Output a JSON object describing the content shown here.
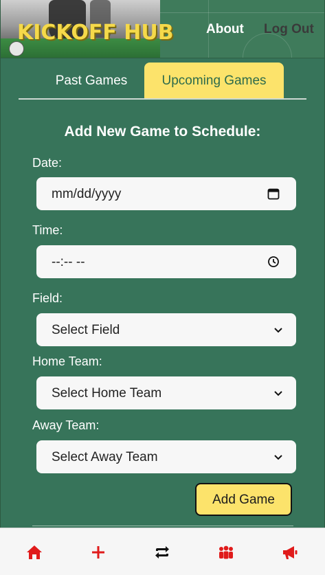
{
  "header": {
    "logo_text": "KICKOFF HUB",
    "nav": {
      "about": "About",
      "logout": "Log Out"
    }
  },
  "tabs": [
    {
      "label": "Past Games",
      "active": false
    },
    {
      "label": "Upcoming Games",
      "active": true
    }
  ],
  "form": {
    "title": "Add New Game to Schedule:",
    "date": {
      "label": "Date:",
      "placeholder": "mm/dd/yyyy"
    },
    "time": {
      "label": "Time:",
      "placeholder": "--:-- --"
    },
    "field": {
      "label": "Field:",
      "selected": "Select Field"
    },
    "home_team": {
      "label": "Home Team:",
      "selected": "Select Home Team"
    },
    "away_team": {
      "label": "Away Team:",
      "selected": "Select Away Team"
    },
    "submit_label": "Add Game"
  },
  "bottom_nav": [
    {
      "icon": "home-icon"
    },
    {
      "icon": "plus-icon"
    },
    {
      "icon": "repeat-icon"
    },
    {
      "icon": "people-icon"
    },
    {
      "icon": "megaphone-icon"
    }
  ],
  "colors": {
    "background": "#37745a",
    "accent_yellow": "#fce36b",
    "nav_icon_red": "#e01b1b"
  }
}
